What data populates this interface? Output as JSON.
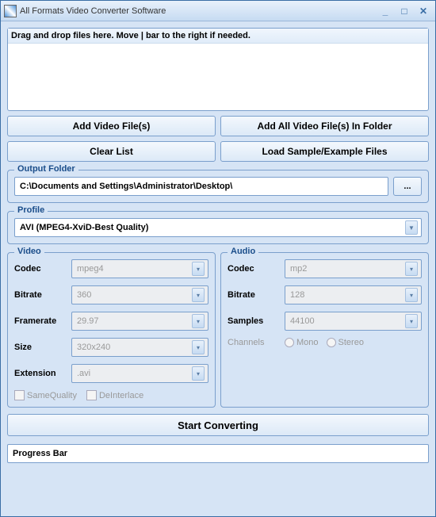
{
  "title": "All Formats Video Converter Software",
  "dropzone_hint": "Drag and drop files here. Move | bar to the right if needed.",
  "buttons": {
    "add_files": "Add Video File(s)",
    "add_folder": "Add All Video File(s) In Folder",
    "clear_list": "Clear List",
    "load_sample": "Load Sample/Example Files"
  },
  "output": {
    "legend": "Output Folder",
    "path": "C:\\Documents and Settings\\Administrator\\Desktop\\",
    "browse": "..."
  },
  "profile": {
    "legend": "Profile",
    "value": "AVI (MPEG4-XviD-Best Quality)"
  },
  "video": {
    "legend": "Video",
    "codec_label": "Codec",
    "codec": "mpeg4",
    "bitrate_label": "Bitrate",
    "bitrate": "360",
    "framerate_label": "Framerate",
    "framerate": "29.97",
    "size_label": "Size",
    "size": "320x240",
    "ext_label": "Extension",
    "ext": ".avi",
    "same_quality": "SameQuality",
    "deinterlace": "DeInterlace"
  },
  "audio": {
    "legend": "Audio",
    "codec_label": "Codec",
    "codec": "mp2",
    "bitrate_label": "Bitrate",
    "bitrate": "128",
    "samples_label": "Samples",
    "samples": "44100",
    "channels_label": "Channels",
    "mono": "Mono",
    "stereo": "Stereo"
  },
  "start": "Start Converting",
  "progress": "Progress Bar"
}
